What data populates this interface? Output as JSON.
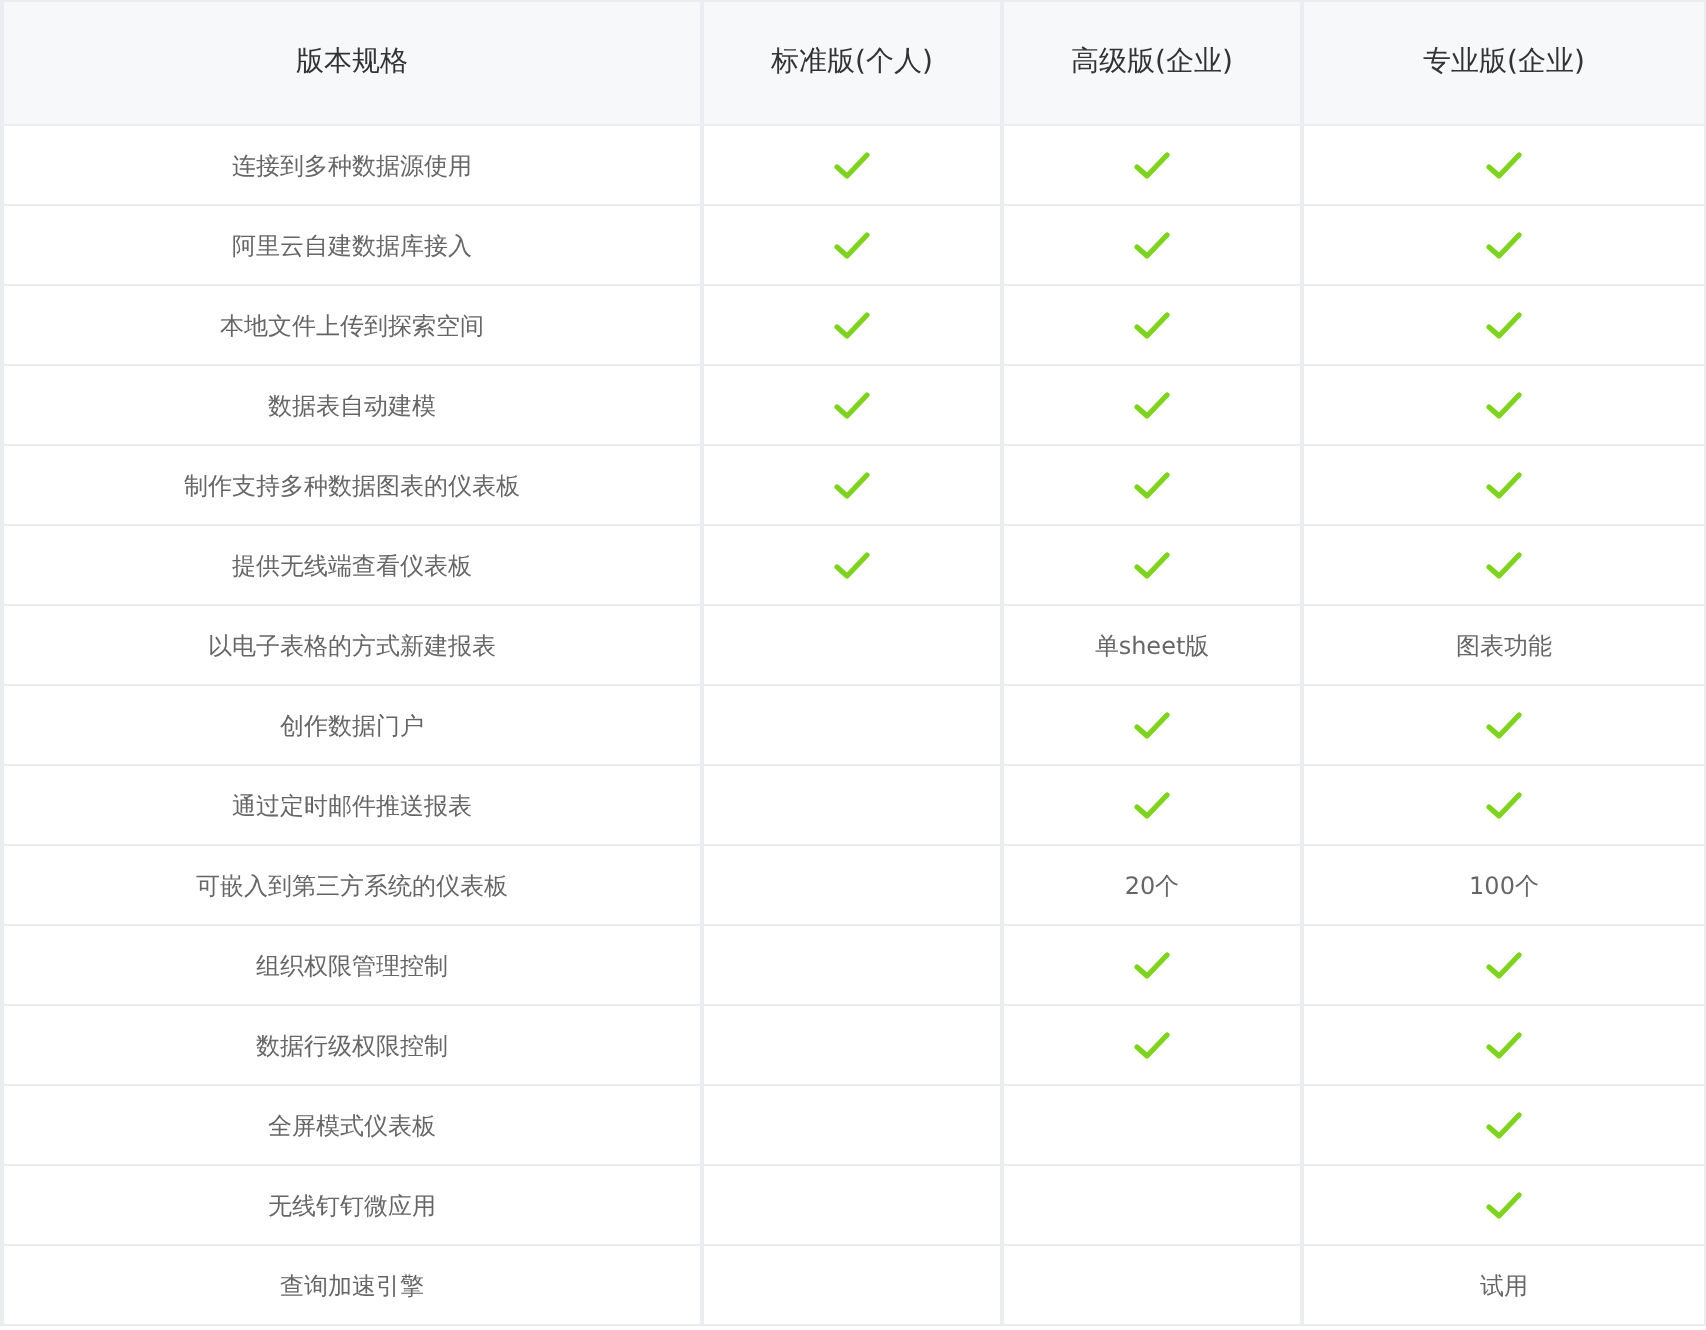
{
  "columns": [
    "版本规格",
    "标准版(个人)",
    "高级版(企业)",
    "专业版(企业)"
  ],
  "rows": [
    {
      "feature": "连接到多种数据源使用",
      "cells": [
        {
          "kind": "check"
        },
        {
          "kind": "check"
        },
        {
          "kind": "check"
        }
      ]
    },
    {
      "feature": "阿里云自建数据库接入",
      "cells": [
        {
          "kind": "check"
        },
        {
          "kind": "check"
        },
        {
          "kind": "check"
        }
      ]
    },
    {
      "feature": "本地文件上传到探索空间",
      "cells": [
        {
          "kind": "check"
        },
        {
          "kind": "check"
        },
        {
          "kind": "check"
        }
      ]
    },
    {
      "feature": "数据表自动建模",
      "cells": [
        {
          "kind": "check"
        },
        {
          "kind": "check"
        },
        {
          "kind": "check"
        }
      ]
    },
    {
      "feature": "制作支持多种数据图表的仪表板",
      "cells": [
        {
          "kind": "check"
        },
        {
          "kind": "check"
        },
        {
          "kind": "check"
        }
      ]
    },
    {
      "feature": "提供无线端查看仪表板",
      "cells": [
        {
          "kind": "check"
        },
        {
          "kind": "check"
        },
        {
          "kind": "check"
        }
      ]
    },
    {
      "feature": "以电子表格的方式新建报表",
      "cells": [
        {
          "kind": "blank"
        },
        {
          "kind": "text",
          "text": "单sheet版"
        },
        {
          "kind": "text",
          "text": "图表功能"
        }
      ]
    },
    {
      "feature": "创作数据门户",
      "cells": [
        {
          "kind": "blank"
        },
        {
          "kind": "check"
        },
        {
          "kind": "check"
        }
      ]
    },
    {
      "feature": "通过定时邮件推送报表",
      "cells": [
        {
          "kind": "blank"
        },
        {
          "kind": "check"
        },
        {
          "kind": "check"
        }
      ]
    },
    {
      "feature": "可嵌入到第三方系统的仪表板",
      "cells": [
        {
          "kind": "blank"
        },
        {
          "kind": "text",
          "text": "20个"
        },
        {
          "kind": "text",
          "text": "100个"
        }
      ]
    },
    {
      "feature": "组织权限管理控制",
      "cells": [
        {
          "kind": "blank"
        },
        {
          "kind": "check"
        },
        {
          "kind": "check"
        }
      ]
    },
    {
      "feature": "数据行级权限控制",
      "cells": [
        {
          "kind": "blank"
        },
        {
          "kind": "check"
        },
        {
          "kind": "check"
        }
      ]
    },
    {
      "feature": "全屏模式仪表板",
      "cells": [
        {
          "kind": "blank"
        },
        {
          "kind": "blank"
        },
        {
          "kind": "check"
        }
      ]
    },
    {
      "feature": "无线钉钉微应用",
      "cells": [
        {
          "kind": "blank"
        },
        {
          "kind": "blank"
        },
        {
          "kind": "check"
        }
      ]
    },
    {
      "feature": "查询加速引擎",
      "cells": [
        {
          "kind": "blank"
        },
        {
          "kind": "blank"
        },
        {
          "kind": "text",
          "text": "试用"
        }
      ]
    }
  ]
}
